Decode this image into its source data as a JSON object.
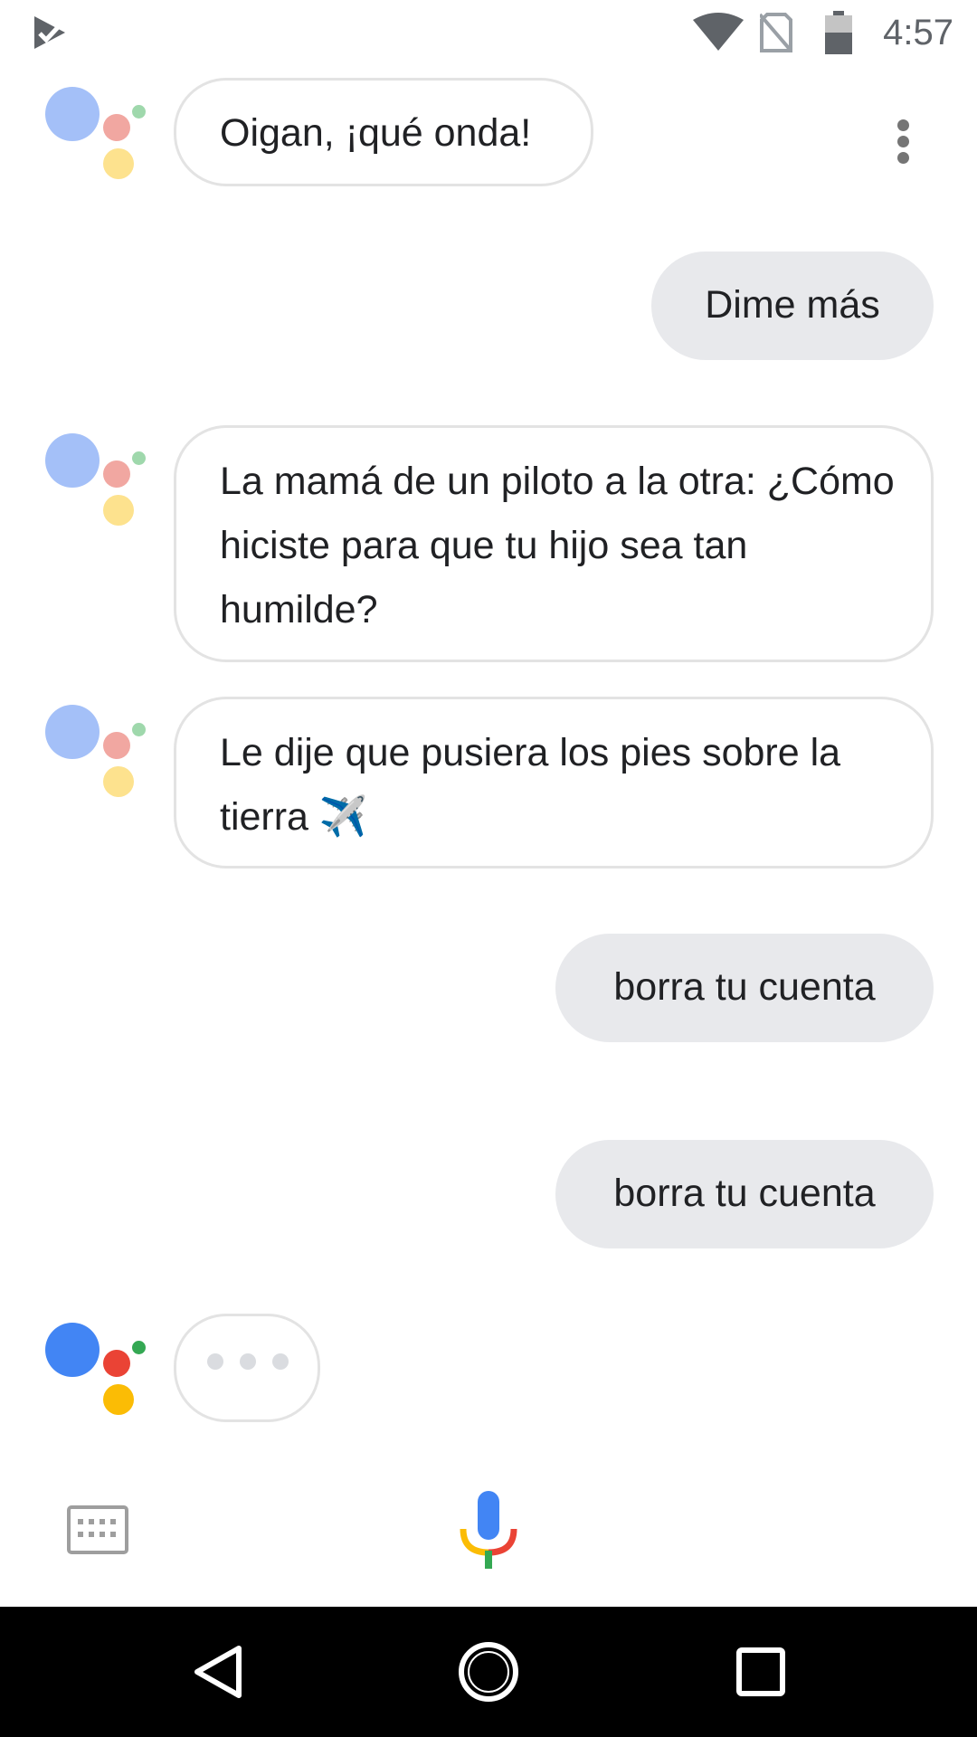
{
  "status_bar": {
    "time": "4:57",
    "icons": [
      "assistant-notification-icon",
      "wifi-icon",
      "no-sim-icon",
      "battery-icon"
    ]
  },
  "header": {
    "menu_icon": "more-vert-icon"
  },
  "conversation": [
    {
      "sender": "assistant",
      "text": "Oigan, ¡qué onda!"
    },
    {
      "sender": "user",
      "text": "Dime más"
    },
    {
      "sender": "assistant",
      "text": "La mamá de un piloto a la otra: ¿Cómo hiciste para que tu hijo sea tan humilde?"
    },
    {
      "sender": "assistant",
      "text": "Le dije que pusiera los pies sobre la tierra ✈️"
    },
    {
      "sender": "user",
      "text": "borra tu cuenta"
    },
    {
      "sender": "user",
      "text": "borra tu cuenta"
    },
    {
      "sender": "assistant",
      "typing": true
    }
  ],
  "input_bar": {
    "keyboard_icon": "keyboard-icon",
    "mic_icon": "mic-icon"
  },
  "nav_bar": {
    "icons": [
      "back-icon",
      "home-icon",
      "recents-icon"
    ]
  },
  "colors": {
    "google_blue": "#4285f4",
    "google_red": "#ea4335",
    "google_yellow": "#fbbc05",
    "google_green": "#34a853",
    "user_bubble": "#e8e9ec",
    "assistant_border": "#e3e3e3"
  }
}
